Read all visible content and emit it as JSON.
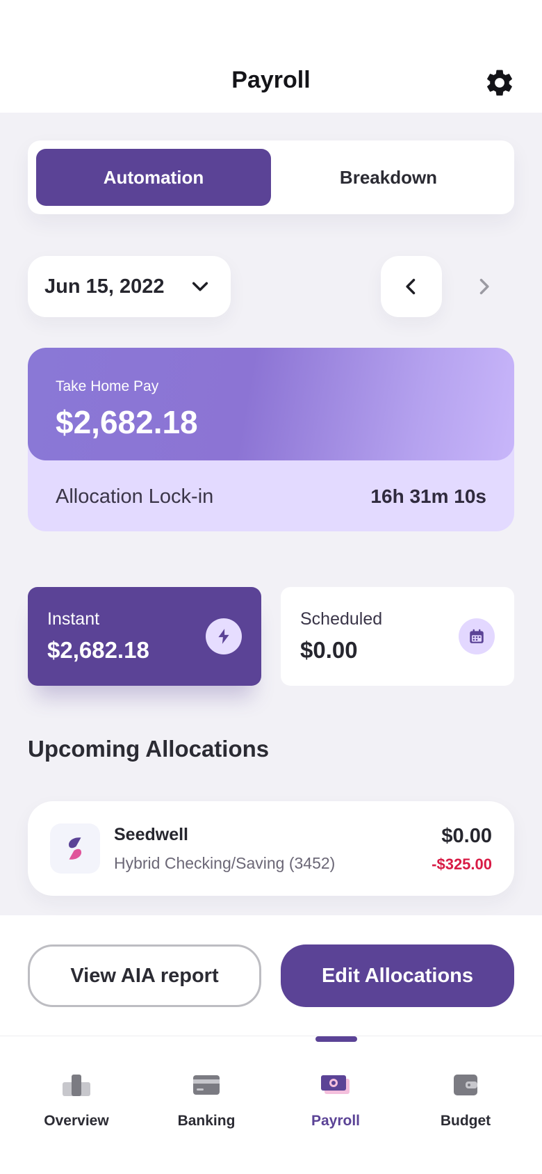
{
  "header": {
    "title": "Payroll",
    "settings_icon": "gear-icon"
  },
  "segments": {
    "active": "Automation",
    "inactive": "Breakdown"
  },
  "date_picker": {
    "value": "Jun 15, 2022",
    "icon": "chevron-down-icon"
  },
  "date_nav": {
    "prev_icon": "chevron-left-icon",
    "next_icon": "chevron-right-icon"
  },
  "take_home": {
    "label": "Take Home Pay",
    "amount": "$2,682.18",
    "lock_label": "Allocation Lock-in",
    "lock_time": "16h 31m 10s"
  },
  "tiles": {
    "instant": {
      "label": "Instant",
      "amount": "$2,682.18",
      "icon": "lightning-icon"
    },
    "scheduled": {
      "label": "Scheduled",
      "amount": "$0.00",
      "icon": "calendar-icon"
    }
  },
  "upcoming": {
    "title": "Upcoming Allocations",
    "items": [
      {
        "name": "Seedwell",
        "account": "Hybrid Checking/Saving (3452)",
        "amount": "$0.00",
        "change": "-$325.00",
        "icon": "seedwell-logo-icon"
      }
    ]
  },
  "actions": {
    "secondary": "View AIA report",
    "primary": "Edit Allocations"
  },
  "tabs": [
    {
      "label": "Overview",
      "icon": "overview-icon",
      "active": false
    },
    {
      "label": "Banking",
      "icon": "card-icon",
      "active": false
    },
    {
      "label": "Payroll",
      "icon": "payroll-icon",
      "active": true
    },
    {
      "label": "Budget",
      "icon": "wallet-icon",
      "active": false
    }
  ],
  "colors": {
    "brand": "#5b4396",
    "negative": "#d81b45",
    "card_light": "#e3daff"
  }
}
